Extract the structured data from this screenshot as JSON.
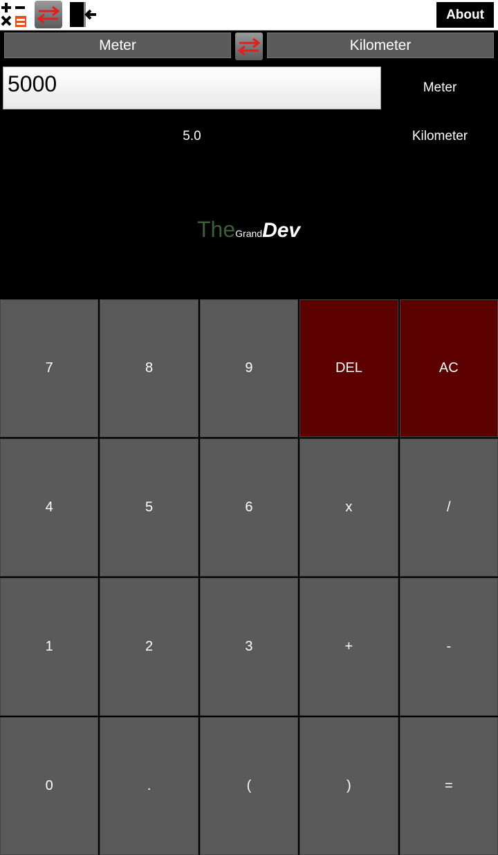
{
  "toolbar": {
    "icons": [
      "calculator-icon",
      "swap-icon",
      "exit-icon"
    ],
    "about_label": "About"
  },
  "units": {
    "from": "Meter",
    "to": "Kilometer"
  },
  "input": {
    "value": "5000"
  },
  "labels": {
    "from_unit": "Meter",
    "to_unit": "Kilometer"
  },
  "result": "5.0",
  "brand": {
    "the": "The",
    "grand": "Grand",
    "dev": "Dev"
  },
  "keys": [
    "7",
    "8",
    "9",
    "DEL",
    "AC",
    "4",
    "5",
    "6",
    "x",
    "/",
    "1",
    "2",
    "3",
    "+",
    "-",
    "0",
    ".",
    "(",
    ")",
    "="
  ],
  "colors": {
    "accent_red": "#e02020",
    "danger_key": "#5c0000",
    "key": "#5a5a5a"
  }
}
